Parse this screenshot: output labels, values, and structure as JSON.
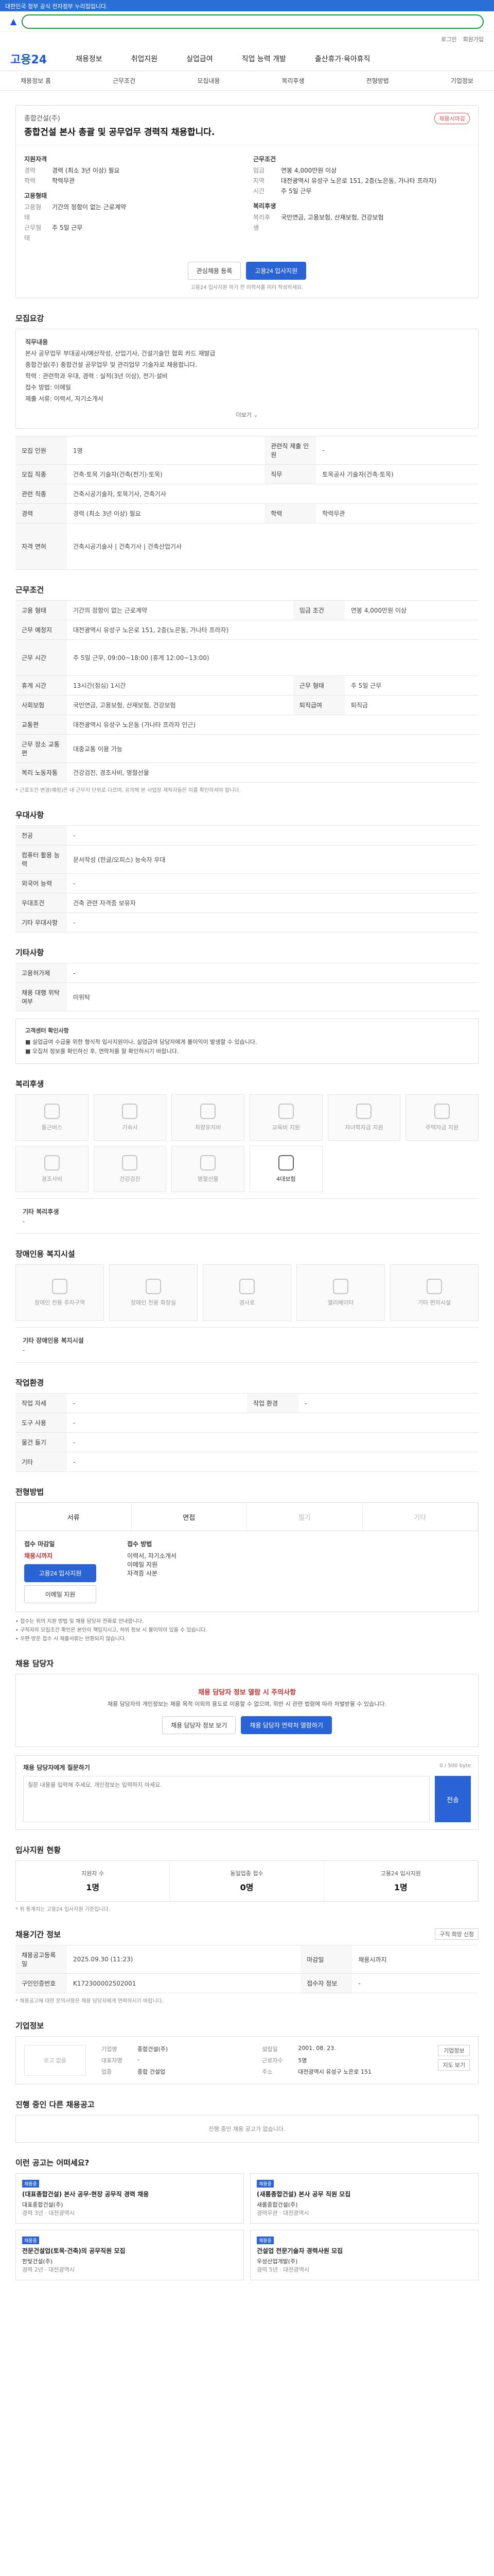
{
  "top": {
    "banner": "대한민국 정부 공식 전자정부 누리집입니다."
  },
  "util": {
    "links": [
      "로그인",
      "회원가입"
    ]
  },
  "gnb": {
    "brand": "고용24",
    "items": [
      "채용정보",
      "취업지원",
      "실업급여",
      "직업 능력 개발",
      "출산휴가·육아휴직"
    ]
  },
  "lnb": {
    "items": [
      "채용정보 홈",
      "근무조건",
      "모집내용",
      "복리후생",
      "전형방법",
      "기업정보"
    ]
  },
  "job": {
    "company": "종합건설(주)",
    "title": "종합건설 본사 총괄 및 공무업무 경력직 채용합니다.",
    "badge": "채용시마감",
    "req_head": "지원자격",
    "cond_head": "근무조건",
    "req": [
      [
        "경력",
        "경력 (최소 3년 이상) 필요"
      ],
      [
        "학력",
        "학력무관"
      ]
    ],
    "cond": [
      [
        "임금",
        "연봉 4,000만원 이상"
      ],
      [
        "지역",
        "대전광역시 유성구 노은로 151, 2층(노은동, 가나타 프라자)"
      ],
      [
        "시간",
        "주 5일 근무"
      ]
    ],
    "form_head": "고용형태",
    "form": [
      [
        "고용형태",
        "기간의 정함이 없는 근로계약"
      ],
      [
        "근무형태",
        "주 5일 근무"
      ]
    ],
    "sub_head": "복리후생",
    "sub": [
      [
        "복리후생",
        "국민연금, 고용보험, 산재보험, 건강보험"
      ]
    ],
    "btn_save": "관심채용 등록",
    "btn_apply": "고용24 입사지원",
    "apply_note": "고용24 입사지원 하기 전 이력서를 미리 작성하세요."
  },
  "recruit": {
    "title": "모집요강",
    "box_head": "직무내용",
    "lines": [
      "본사 공무업무 부대공사/예산작성, 산업기사, 건설기술인 협회 카드 재발급",
      "종합건설(주) 종합건설 공무업무 및 관리업무 기술자로 채용합니다.",
      "학력 : 관련학과 우대, 경력 : 실적(3년 이상), 전기·설비",
      "접수 방법: 이메일",
      "제출 서류: 이력서, 자기소개서"
    ],
    "more": "더보기 ⌄"
  },
  "recruit_table": [
    [
      "모집 인원",
      "1명",
      "관련직 제출 인원",
      "-"
    ],
    [
      "모집 직종",
      "건축·토목 기술자(건축(전기)·토목)",
      "직무",
      "토목공사 기술자(건축·토목)"
    ],
    [
      "관련 직종",
      "건축시공기술자, 토목기사, 건축기사",
      "",
      ""
    ],
    [
      "경력",
      "경력 (최소 3년 이상) 필요",
      "학력",
      "학력무관"
    ],
    [
      "자격 면허",
      "건축시공기술사 | 건축기사 | 건축산업기사",
      "",
      ""
    ]
  ],
  "work": {
    "title": "근무조건",
    "rows": [
      [
        "고용 형태",
        "기간의 정함이 없는 근로계약",
        "임금 조건",
        "연봉 4,000만원 이상"
      ],
      [
        "근무 예정지",
        "대전광역시 유성구 노은로 151, 2층(노은동, 가나타 프라자)",
        "",
        ""
      ],
      [
        "근무 시간",
        "주 5일 근무, 09:00~18:00 (휴게 12:00~13:00)",
        "",
        ""
      ],
      [
        "휴게 시간",
        "13시간(점심) 1시간",
        "근무 형태",
        "주 5일 근무"
      ],
      [
        "사회보험",
        "국민연금, 고용보험, 산재보험, 건강보험",
        "퇴직급여",
        "퇴직금"
      ],
      [
        "교통편",
        "대전광역시 유성구 노은동 (가나타 프라자 인근)",
        "",
        ""
      ],
      [
        "근무 장소 교통편",
        "대중교통 이용 가능",
        "",
        ""
      ],
      [
        "복리 노동자통",
        "건강검진, 경조사비, 명절선물",
        "",
        ""
      ]
    ],
    "note": "* 근로조건 변경(예정)은 내 근무지 단위로 다르며, 유의해 본 사업장 재직자들은 이를 확인하셔야 합니다."
  },
  "prefer": {
    "title": "우대사항",
    "rows": [
      [
        "전공",
        "-"
      ],
      [
        "컴퓨터 활용 능력",
        "문서작성 (한글/오피스) 능숙자 우대"
      ],
      [
        "외국어 능력",
        "-"
      ],
      [
        "우대조건",
        "건축 관련 자격증 보유자"
      ],
      [
        "기타 우대사항",
        "-"
      ]
    ]
  },
  "etc": {
    "title": "기타사항",
    "rows": [
      [
        "고용허가제",
        "-"
      ],
      [
        "채용 대행 위탁 여부",
        "미위탁"
      ]
    ],
    "notice_title": "고객센터 확인사항",
    "notice": [
      "■ 실업급여 수급을 위한 형식적 입사지원이나, 실업급여 담당자에게 불이익이 발생할 수 있습니다.",
      "■ 모집처 정보를 확인하신 후, 연락처를 잘 확인하시기 바랍니다."
    ]
  },
  "welfare": {
    "title": "복리후생",
    "items": [
      "통근버스",
      "기숙사",
      "차량유지비",
      "교육비 지원",
      "자녀학자금 지원",
      "주택자금 지원",
      "경조사비",
      "건강검진",
      "명절선물",
      "4대보험"
    ],
    "other_title": "기타 복리후생",
    "other_value": "-"
  },
  "disabled": {
    "title": "장애인용 복지시설",
    "items": [
      "장애인 전용 주차구역",
      "장애인 전용 화장실",
      "경사로",
      "엘리베이터",
      "기타 편의시설"
    ],
    "other_title": "기타 장애인용 복지시설",
    "other_value": "-"
  },
  "env": {
    "title": "작업환경",
    "rows": [
      [
        "작업 자세",
        "-",
        "작업 환경",
        "-"
      ],
      [
        "도구 사용",
        "-",
        "",
        ""
      ],
      [
        "물건 들기",
        "-",
        "",
        ""
      ],
      [
        "기타",
        "-",
        "",
        ""
      ]
    ]
  },
  "method": {
    "title": "전형방법",
    "tabs": [
      "서류",
      "면접",
      "필기",
      "기타"
    ],
    "apply_head": "접수 마감일",
    "apply_date": "채용시까지",
    "apply_btn": "고용24 입사지원",
    "email_btn": "이메일 지원",
    "docs_head": "접수 방법",
    "docs": [
      "이력서, 자기소개서",
      "이메일 지원",
      "자격증 사본"
    ],
    "notes": [
      "• 접수는 위의 지원 방법 및 채용 담당자 전화로 안내합니다.",
      "• 구직자의 모집조건 확인은 본인이 책임지시고, 허위 정보 시 불이익이 있을 수 있습니다.",
      "• 우편·방문 접수 시 제출서류는 반환되지 않습니다."
    ]
  },
  "manager": {
    "title": "채용 담당자",
    "warn": "채용 담당자 정보 열람 시 주의사항",
    "body": "채용 담당자의 개인정보는 채용 목적 이외의 용도로 이용할 수 없으며, 위반 시 관련 법령에 따라 처벌받을 수 있습니다.",
    "btn_info": "채용 담당자 정보 보기",
    "btn_open": "채용 담당자 연락처 열람하기",
    "inquiry_title": "채용 담당자에게 질문하기",
    "inquiry_count": "0 / 500 byte",
    "inquiry_placeholder": "질문 내용을 입력해 주세요. 개인정보는 입력하지 마세요.",
    "inquiry_send": "전송"
  },
  "stats": {
    "title": "입사지원 현황",
    "items": [
      [
        "지원자 수",
        "1명"
      ],
      [
        "동일업종 접수",
        "0명"
      ],
      [
        "고용24 입사지원",
        "1명"
      ]
    ],
    "note": "* 위 통계치는 고용24 입사지원 기준입니다."
  },
  "info": {
    "title": "채용기간 정보",
    "btn": "구직 희망 신청",
    "rows": [
      [
        "채용공고등록일",
        "2025.09.30 (11:23)",
        "마감일",
        "채용시까지"
      ],
      [
        "구인인증번호",
        "K172300002502001",
        "접수자 정보",
        "-"
      ]
    ],
    "note": "* 채용공고에 대한 문의사항은 채용 담당자에게 연락하시기 바랍니다."
  },
  "company": {
    "title": "기업정보",
    "logo": "로고 없음",
    "rows": [
      [
        "기업명",
        "종합건설(주)"
      ],
      [
        "대표자명",
        "-"
      ],
      [
        "업종",
        "종합 건설업"
      ],
      [
        "설립일",
        "2001. 08. 23."
      ],
      [
        "근로자수",
        "5명"
      ],
      [
        "주소",
        "대전광역시 유성구 노은로 151"
      ]
    ],
    "btn_info": "기업정보",
    "btn_map": "지도 보기"
  },
  "other_jobs": {
    "title": "진행 중인 다른 채용공고",
    "empty": "진행 중인 채용 공고가 없습니다."
  },
  "recommend": {
    "title": "이런 공고는 어떠세요?",
    "cards": [
      {
        "tag": "채용중",
        "title": "(대표종합건설) 본사 공무·현장 공무직 경력 채용",
        "company": "대표종합건설(주)",
        "meta": "경력 3년 · 대전광역시"
      },
      {
        "tag": "채용중",
        "title": "(새롬종합건설) 본사 공무 직원 모집",
        "company": "새롬종합건설(주)",
        "meta": "경력무관 · 대전광역시"
      },
      {
        "tag": "채용중",
        "title": "전문건설업(토목·건축)의 공무직원 모집",
        "company": "한빛건설(주)",
        "meta": "경력 2년 · 대전광역시"
      },
      {
        "tag": "채용중",
        "title": "건설업 전문기술자 경력사원 모집",
        "company": "우성산업개발(주)",
        "meta": "경력 5년 · 대전광역시"
      }
    ]
  }
}
